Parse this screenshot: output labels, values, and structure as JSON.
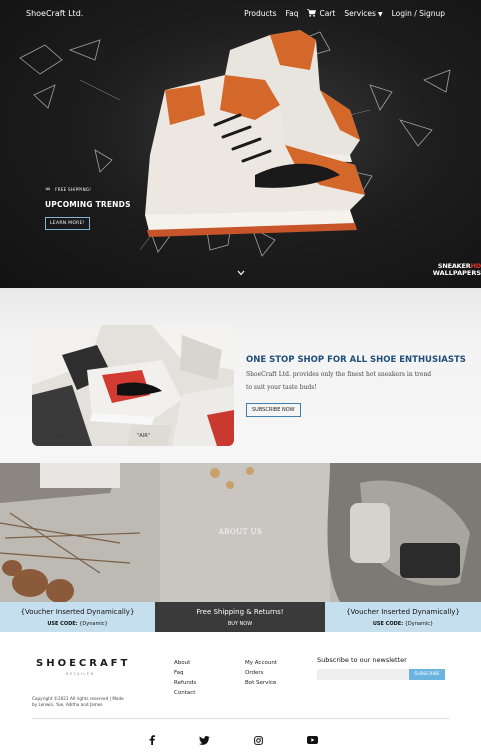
{
  "nav": {
    "brand": "ShoeCraft Ltd.",
    "items": {
      "products": "Products",
      "faq": "Faq",
      "cart": "Cart",
      "services": "Services",
      "login": "Login / Signup"
    }
  },
  "hero": {
    "tag": "FREE SHIPPING!",
    "heading": "UPCOMING TRENDS",
    "button": "LEARN MORE!",
    "watermark_line1": "SNEAKER",
    "watermark_accent": "HD",
    "watermark_line2": "WALLPAPERS"
  },
  "promo": {
    "title": "ONE STOP SHOP FOR ALL SHOE ENTHUSIASTS",
    "text_line1": "ShoeCraft Ltd. provides only the finest hot sneakers in trend",
    "text_line2": "to suit your taste buds!",
    "button": "SUBSCRIBE NOW"
  },
  "about": {
    "label": "ABOUT US"
  },
  "vouchers": [
    {
      "title": "{Voucher Inserted Dynamically}",
      "code_prefix": "USE CODE:",
      "code": "{Dynamic}"
    },
    {
      "title": "Free Shipping & Returns!",
      "action": "BUY NOW"
    },
    {
      "title": "{Voucher Inserted Dynamically}",
      "code_prefix": "USE CODE:",
      "code": "{Dynamic}"
    }
  ],
  "footer": {
    "logo": "SHOECRAFT",
    "logo_sub": "RETAILER",
    "copyright": "Copyright ©2021 All rights reserved | Made by Lenwin, Yue, Aditha and James",
    "col1": [
      "About",
      "Faq",
      "Refunds",
      "Contact"
    ],
    "col2": [
      "My Account",
      "Orders",
      "Bot Service"
    ],
    "newsletter_title": "Subscribe to our newsletter",
    "newsletter_placeholder": "",
    "newsletter_button": "SUBSCRIBE"
  },
  "colors": {
    "accent_blue": "#1f4e79",
    "voucher_light": "#c6dfee",
    "voucher_dark": "#3a3a3a",
    "subscribe_button": "#6cb4e0",
    "shoe_orange": "#d4672a"
  },
  "icons": [
    "cart-icon",
    "chevron-down-icon",
    "facebook-icon",
    "twitter-icon",
    "instagram-icon",
    "youtube-icon"
  ]
}
